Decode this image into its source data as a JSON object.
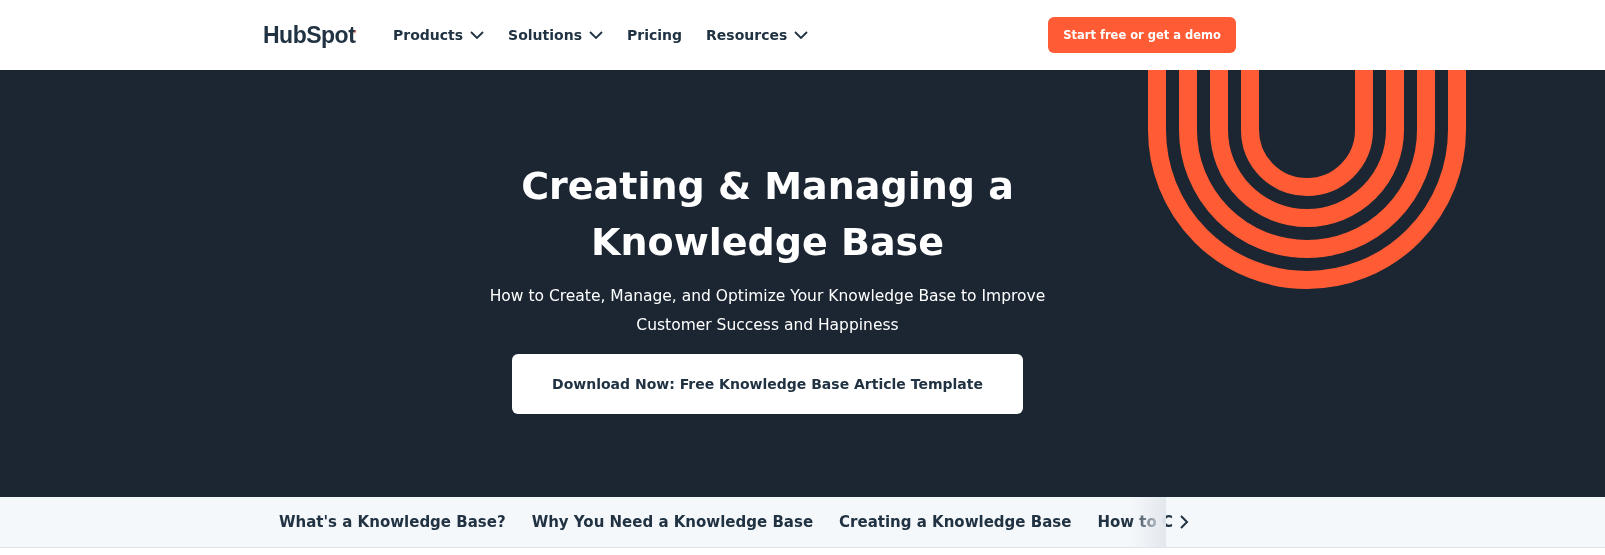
{
  "header": {
    "logo": "HubSpot",
    "nav": [
      {
        "label": "Products",
        "dropdown": true
      },
      {
        "label": "Solutions",
        "dropdown": true
      },
      {
        "label": "Pricing",
        "dropdown": false
      },
      {
        "label": "Resources",
        "dropdown": true
      }
    ],
    "cta": "Start free or get a demo"
  },
  "hero": {
    "title_lines": [
      "Creating & Managing a",
      "Knowledge Base"
    ],
    "subtitle_lines": [
      "How to Create, Manage, and Optimize Your Knowledge Base to Improve",
      "Customer Success and Happiness"
    ],
    "button": "Download Now: Free Knowledge Base Article Template"
  },
  "section_tabs": [
    "What's a Knowledge Base?",
    "Why You Need a Knowledge Base",
    "Creating a Knowledge Base",
    "How to C"
  ]
}
